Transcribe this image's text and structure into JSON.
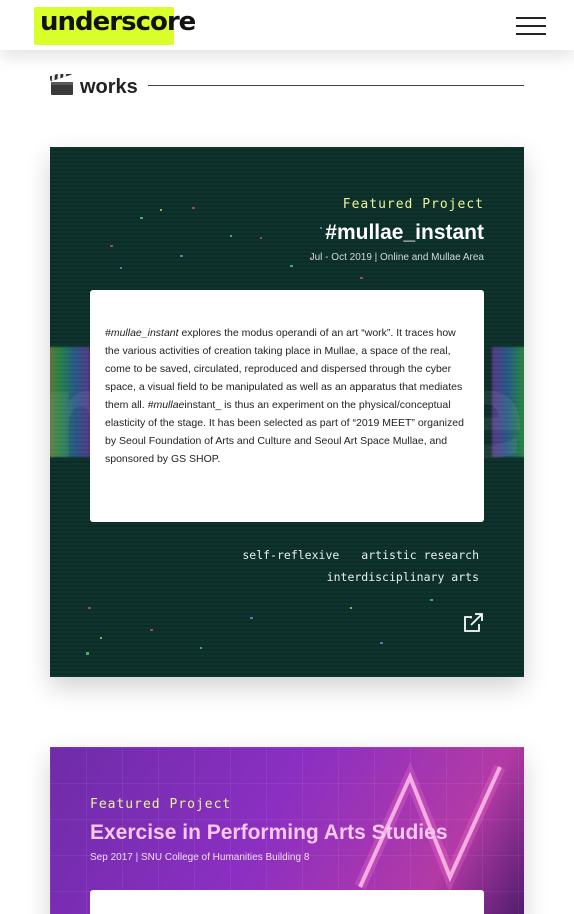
{
  "header": {
    "logo_text": "underscore",
    "menu_icon": "hamburger-menu-icon"
  },
  "section": {
    "emoji_icon": "clapper-board-icon",
    "title": "works"
  },
  "projects": [
    {
      "kicker": "Featured Project",
      "title": "#mullae_instant",
      "meta": "Jul - Oct 2019 | Online and Mullae Area",
      "background_word": "mullae_instant",
      "desc_italic_1": "#mullae_instant",
      "desc_1": " explores the modus operandi of an art “work”. It traces how the various activities of creation taking place in Mullae, a space of the real, come to be saved, circulated, reproduced and dispersed through the cyber space, a visual field to be manipulated as well as an apparatus that mediates them all. ",
      "desc_italic_2": "#mullae",
      "desc_2": "instant_ is thus an experiment on the physical/conceptual elasticity of the stage. It has been selected as part of “2019 MEET” organized by Seoul Foundation of Arts and Culture and Seoul Art Space Mullae, and sponsored by GS SHOP.",
      "tags": [
        "self-reflexive",
        "artistic research",
        "interdisciplinary arts"
      ],
      "link_icon": "external-link-icon"
    },
    {
      "kicker": "Featured Project",
      "title": "Exercise in Performing Arts Studies",
      "meta": "Sep 2017 | SNU College of Humanities Building 8"
    }
  ],
  "colors": {
    "accent": "#e9f59a",
    "logo_highlight": "#d8ff2a",
    "card1_bg": "#0b2f29",
    "card2_bg": "#8b2fc2"
  }
}
